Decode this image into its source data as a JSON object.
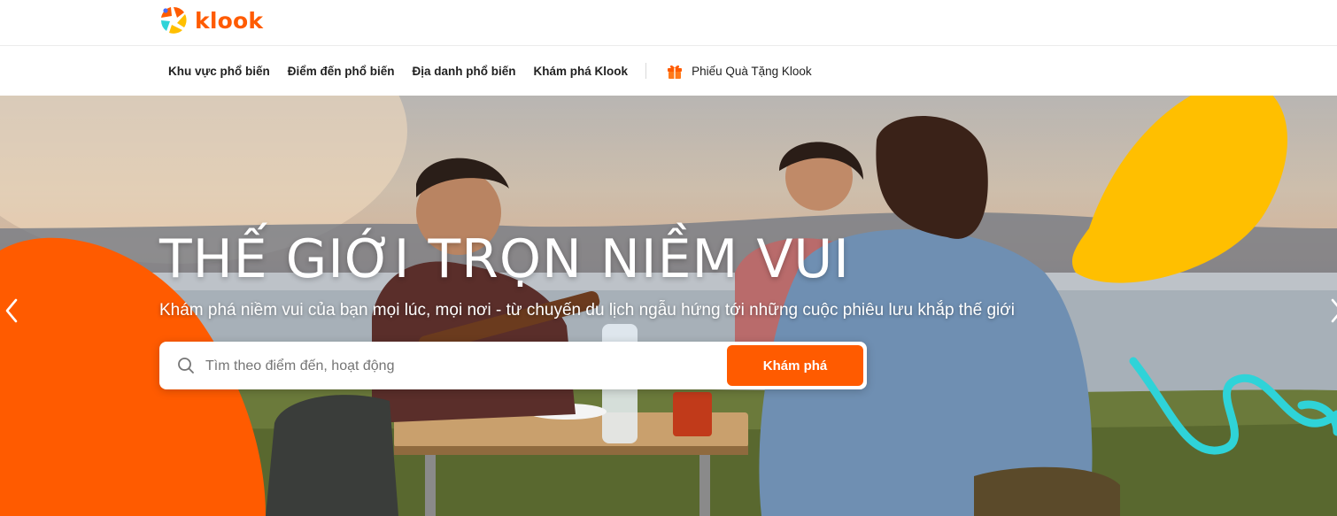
{
  "brand": {
    "name": "klook",
    "accent": "#ff5b00"
  },
  "nav": {
    "items": [
      {
        "label": "Khu vực phổ biến"
      },
      {
        "label": "Điểm đến phổ biến"
      },
      {
        "label": "Địa danh phổ biến"
      },
      {
        "label": "Khám phá Klook"
      }
    ],
    "gift": {
      "label": "Phiếu Quà Tặng Klook",
      "icon": "gift-icon"
    }
  },
  "hero": {
    "title": "THẾ GIỚI TRỌN NIỀM VUI",
    "subtitle": "Khám phá niềm vui của bạn mọi lúc, mọi nơi - từ chuyến du lịch ngẫu hứng tới những cuộc phiêu lưu khắp thế giới",
    "search": {
      "placeholder": "Tìm theo điểm đến, hoạt động",
      "value": "",
      "button_label": "Khám phá"
    },
    "colors": {
      "orange": "#ff5b00",
      "yellow": "#ffbf00",
      "teal": "#2fd3d8"
    }
  }
}
